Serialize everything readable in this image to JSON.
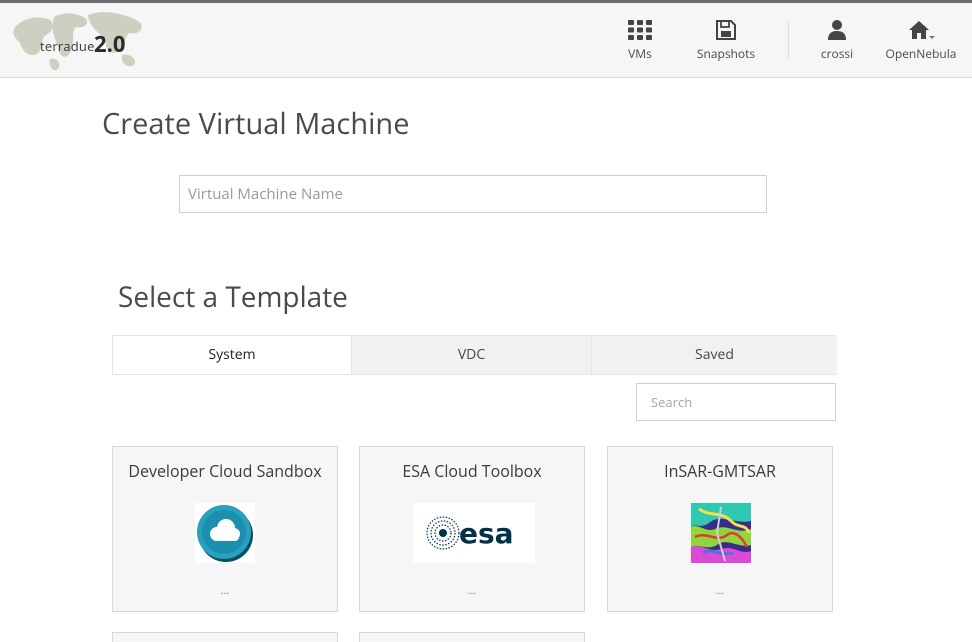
{
  "header": {
    "logo": {
      "text": "terradue",
      "number": "2.0"
    },
    "nav": {
      "vms": {
        "label": "VMs",
        "icon": "grid-icon"
      },
      "snapshots": {
        "label": "Snapshots",
        "icon": "floppy-disk-icon"
      },
      "user": {
        "label": "crossi",
        "icon": "user-icon"
      },
      "zone": {
        "label": "OpenNebula",
        "icon": "home-icon"
      }
    }
  },
  "main": {
    "title": "Create Virtual Machine",
    "vm_name_placeholder": "Virtual Machine Name",
    "template_section_title": "Select a Template",
    "tabs": [
      {
        "label": "System",
        "active": true
      },
      {
        "label": "VDC",
        "active": false
      },
      {
        "label": "Saved",
        "active": false
      }
    ],
    "search_placeholder": "Search",
    "templates": [
      {
        "name": "Developer Cloud Sandbox",
        "description": "...",
        "logo": "cloud-logo"
      },
      {
        "name": "ESA Cloud Toolbox",
        "description": "...",
        "logo": "esa-logo"
      },
      {
        "name": "InSAR-GMTSAR",
        "description": "...",
        "logo": "interferogram-image"
      }
    ]
  },
  "colors": {
    "header_bg": "#f6f6f6",
    "card_bg": "#f6f6f6",
    "esa_blue": "#003247",
    "cloud_teal": "#1a8fad"
  }
}
